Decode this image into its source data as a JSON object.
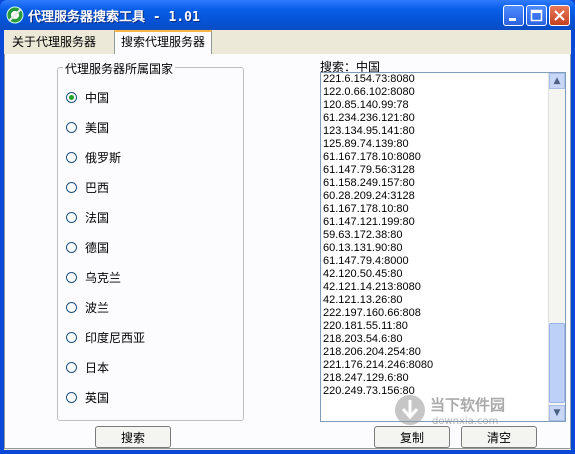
{
  "window": {
    "title": "代理服务器搜索工具 - 1.01"
  },
  "tabs": [
    {
      "label": "关于代理服务器",
      "active": false
    },
    {
      "label": "搜索代理服务器",
      "active": true
    }
  ],
  "country_group": {
    "title": "代理服务器所属国家",
    "options": [
      {
        "label": "中国",
        "checked": true
      },
      {
        "label": "美国",
        "checked": false
      },
      {
        "label": "俄罗斯",
        "checked": false
      },
      {
        "label": "巴西",
        "checked": false
      },
      {
        "label": "法国",
        "checked": false
      },
      {
        "label": "德国",
        "checked": false
      },
      {
        "label": "乌克兰",
        "checked": false
      },
      {
        "label": "波兰",
        "checked": false
      },
      {
        "label": "印度尼西亚",
        "checked": false
      },
      {
        "label": "日本",
        "checked": false
      },
      {
        "label": "英国",
        "checked": false
      }
    ]
  },
  "results": {
    "label": "搜索：中国",
    "items": [
      "221.6.154.73:8080",
      "122.0.66.102:8080",
      "120.85.140.99:78",
      "61.234.236.121:80",
      "123.134.95.141:80",
      "125.89.74.139:80",
      "61.167.178.10:8080",
      "61.147.79.56:3128",
      "61.158.249.157:80",
      "60.28.209.24:3128",
      "61.167.178.10:80",
      "61.147.121.199:80",
      "59.63.172.38:80",
      "60.13.131.90:80",
      "61.147.79.4:8000",
      "42.120.50.45:80",
      "42.121.14.213:8080",
      "42.121.13.26:80",
      "222.197.160.66:808",
      "220.181.55.11:80",
      "218.203.54.6:80",
      "218.206.204.254:80",
      "221.176.214.246:8080",
      "218.247.129.6:80",
      "220.249.73.156:80"
    ]
  },
  "buttons": {
    "search": "搜索",
    "copy": "复制",
    "clear": "清空"
  },
  "watermark": {
    "text": "当下软件园",
    "sub": "downxia.com"
  },
  "colors": {
    "titlebar": "#0553d6",
    "face": "#ece9d8",
    "tab_highlight": "#f9b645",
    "radio_dot": "#21a121"
  }
}
